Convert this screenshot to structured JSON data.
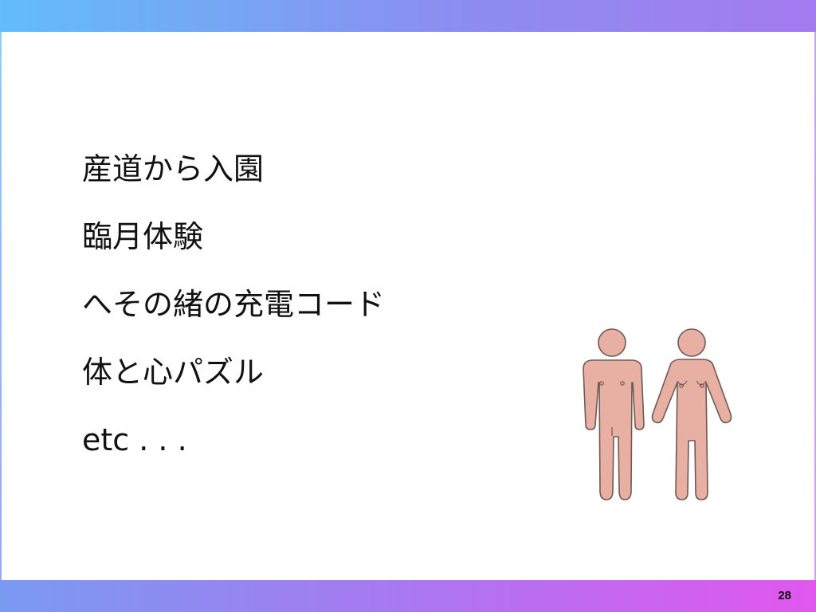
{
  "slide": {
    "items": [
      "産道から入園",
      "臨月体験",
      "へその緒の充電コード",
      "体と心パズル",
      "etc . . ."
    ],
    "page_number": "28",
    "illustration": {
      "icon": "man-and-woman-figure-icon",
      "fill_color": "#e8b0a3",
      "stroke_color": "#6f5a55"
    }
  }
}
